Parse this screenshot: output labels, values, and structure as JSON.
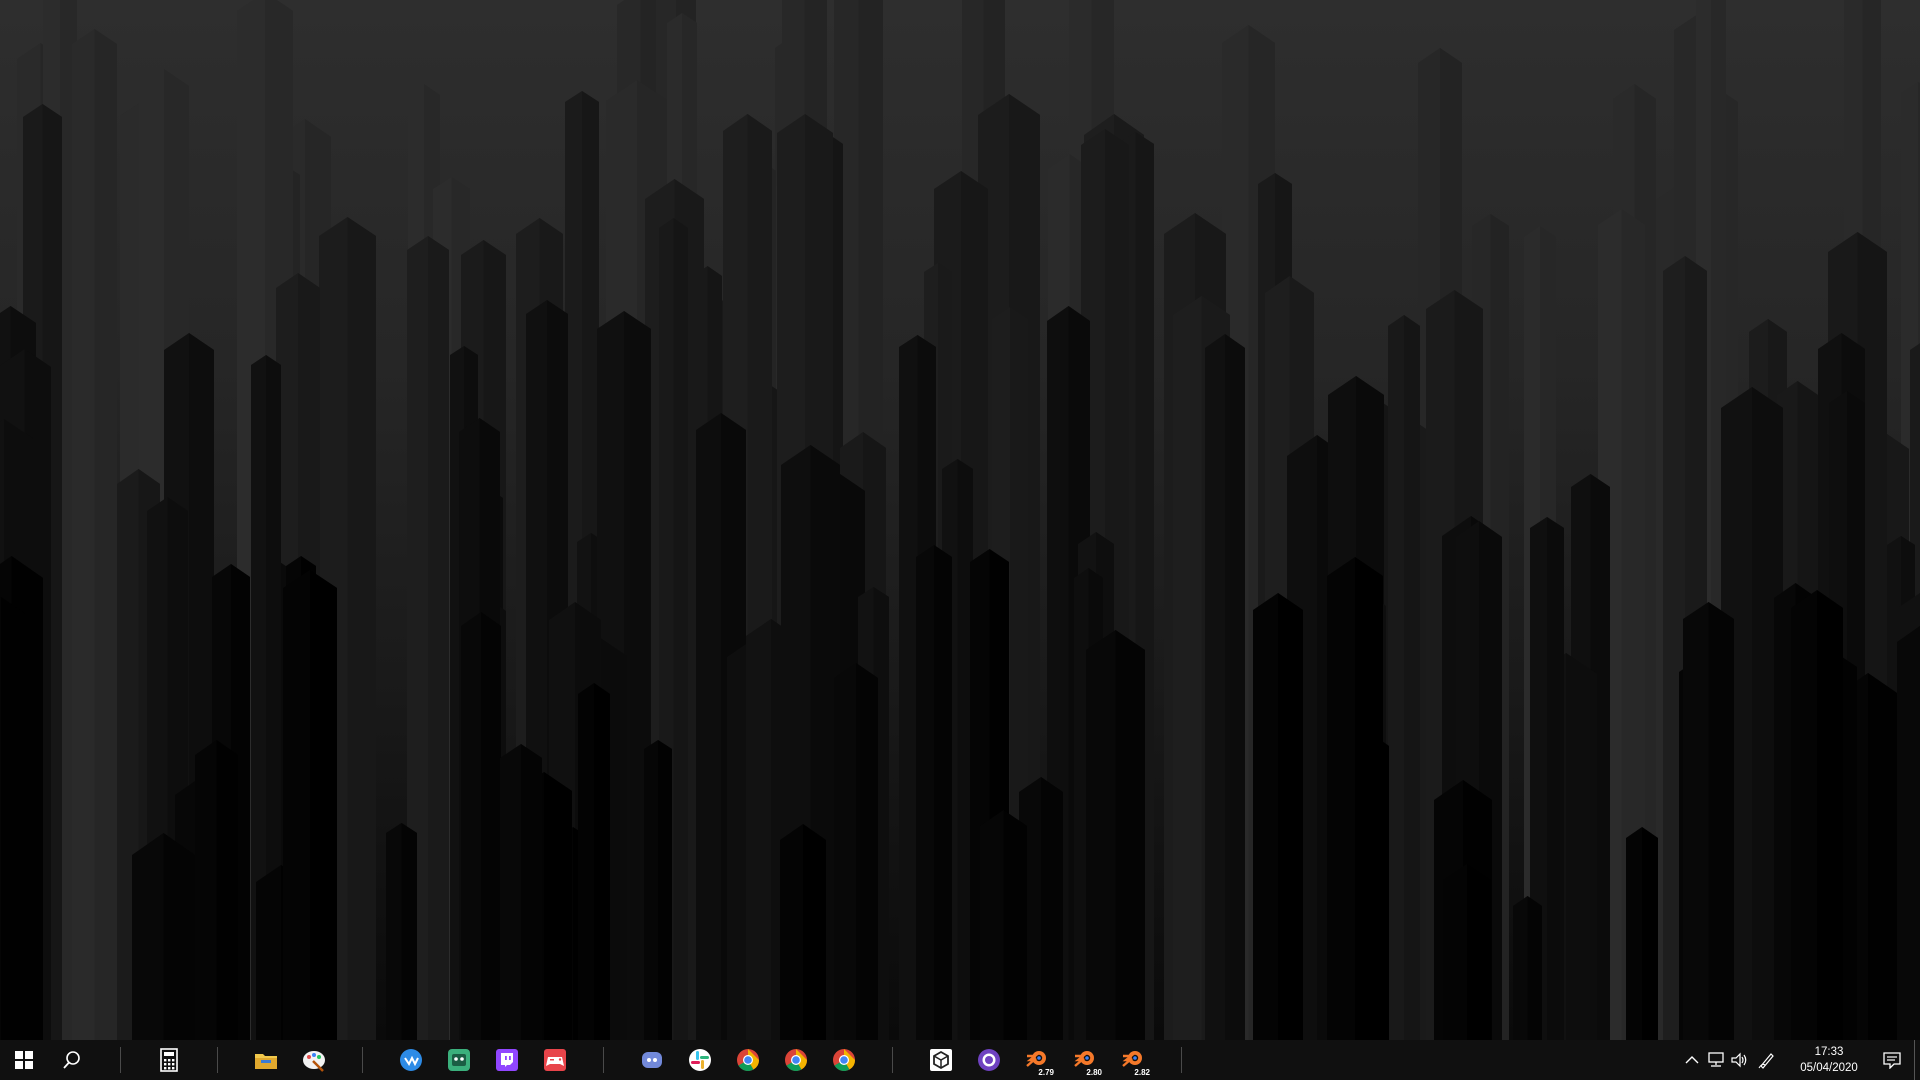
{
  "desktop": {
    "wallpaper": "dark-crystal-pillars",
    "colors": {
      "top": "#2e2e2e",
      "bottom": "#0a0a0a"
    }
  },
  "taskbar": {
    "background": "#101010",
    "start_icon": "windows-logo-icon",
    "search_icon": "search-icon",
    "pinned_groups": [
      [
        {
          "name": "calculator",
          "icon": "calculator-icon",
          "color": "#ffffff"
        }
      ],
      [
        {
          "name": "file-explorer",
          "icon": "folder-icon",
          "color": "#f2c94c"
        },
        {
          "name": "paint-app",
          "icon": "paint-palette-icon",
          "color": "#e24c4c"
        }
      ],
      [
        {
          "name": "app-blue-circle",
          "icon": "blue-circle-app-icon",
          "color": "#2d8be6"
        },
        {
          "name": "app-green-square",
          "icon": "green-square-app-icon",
          "color": "#3bb07c"
        },
        {
          "name": "twitch",
          "icon": "twitch-icon",
          "color": "#9146ff"
        },
        {
          "name": "game-controller",
          "icon": "game-controller-icon",
          "color": "#e8444a"
        }
      ],
      [
        {
          "name": "discord",
          "icon": "discord-icon",
          "color": "#7289da"
        },
        {
          "name": "slack",
          "icon": "slack-icon",
          "color": "#4a154b"
        },
        {
          "name": "chrome-profile-1",
          "icon": "chrome-icon",
          "color": "#4285f4"
        },
        {
          "name": "chrome-profile-2",
          "icon": "chrome-icon",
          "color": "#4285f4"
        },
        {
          "name": "chrome",
          "icon": "chrome-icon",
          "color": "#4285f4"
        }
      ],
      [
        {
          "name": "unity",
          "icon": "unity-icon",
          "color": "#ffffff"
        },
        {
          "name": "app-purple-circle",
          "icon": "purple-circle-app-icon",
          "color": "#6f42c1"
        },
        {
          "name": "blender-279",
          "icon": "blender-icon",
          "color": "#f5792a",
          "badge": "2.79"
        },
        {
          "name": "blender-280",
          "icon": "blender-icon",
          "color": "#f5792a",
          "badge": "2.80"
        },
        {
          "name": "blender-282",
          "icon": "blender-icon",
          "color": "#f5792a",
          "badge": "2.82"
        }
      ]
    ],
    "tray": {
      "icons": [
        "chevron-up-icon",
        "network-icon",
        "volume-icon",
        "pen-icon"
      ],
      "time": "17:33",
      "date": "05/04/2020",
      "notification_icon": "notification-icon"
    }
  }
}
